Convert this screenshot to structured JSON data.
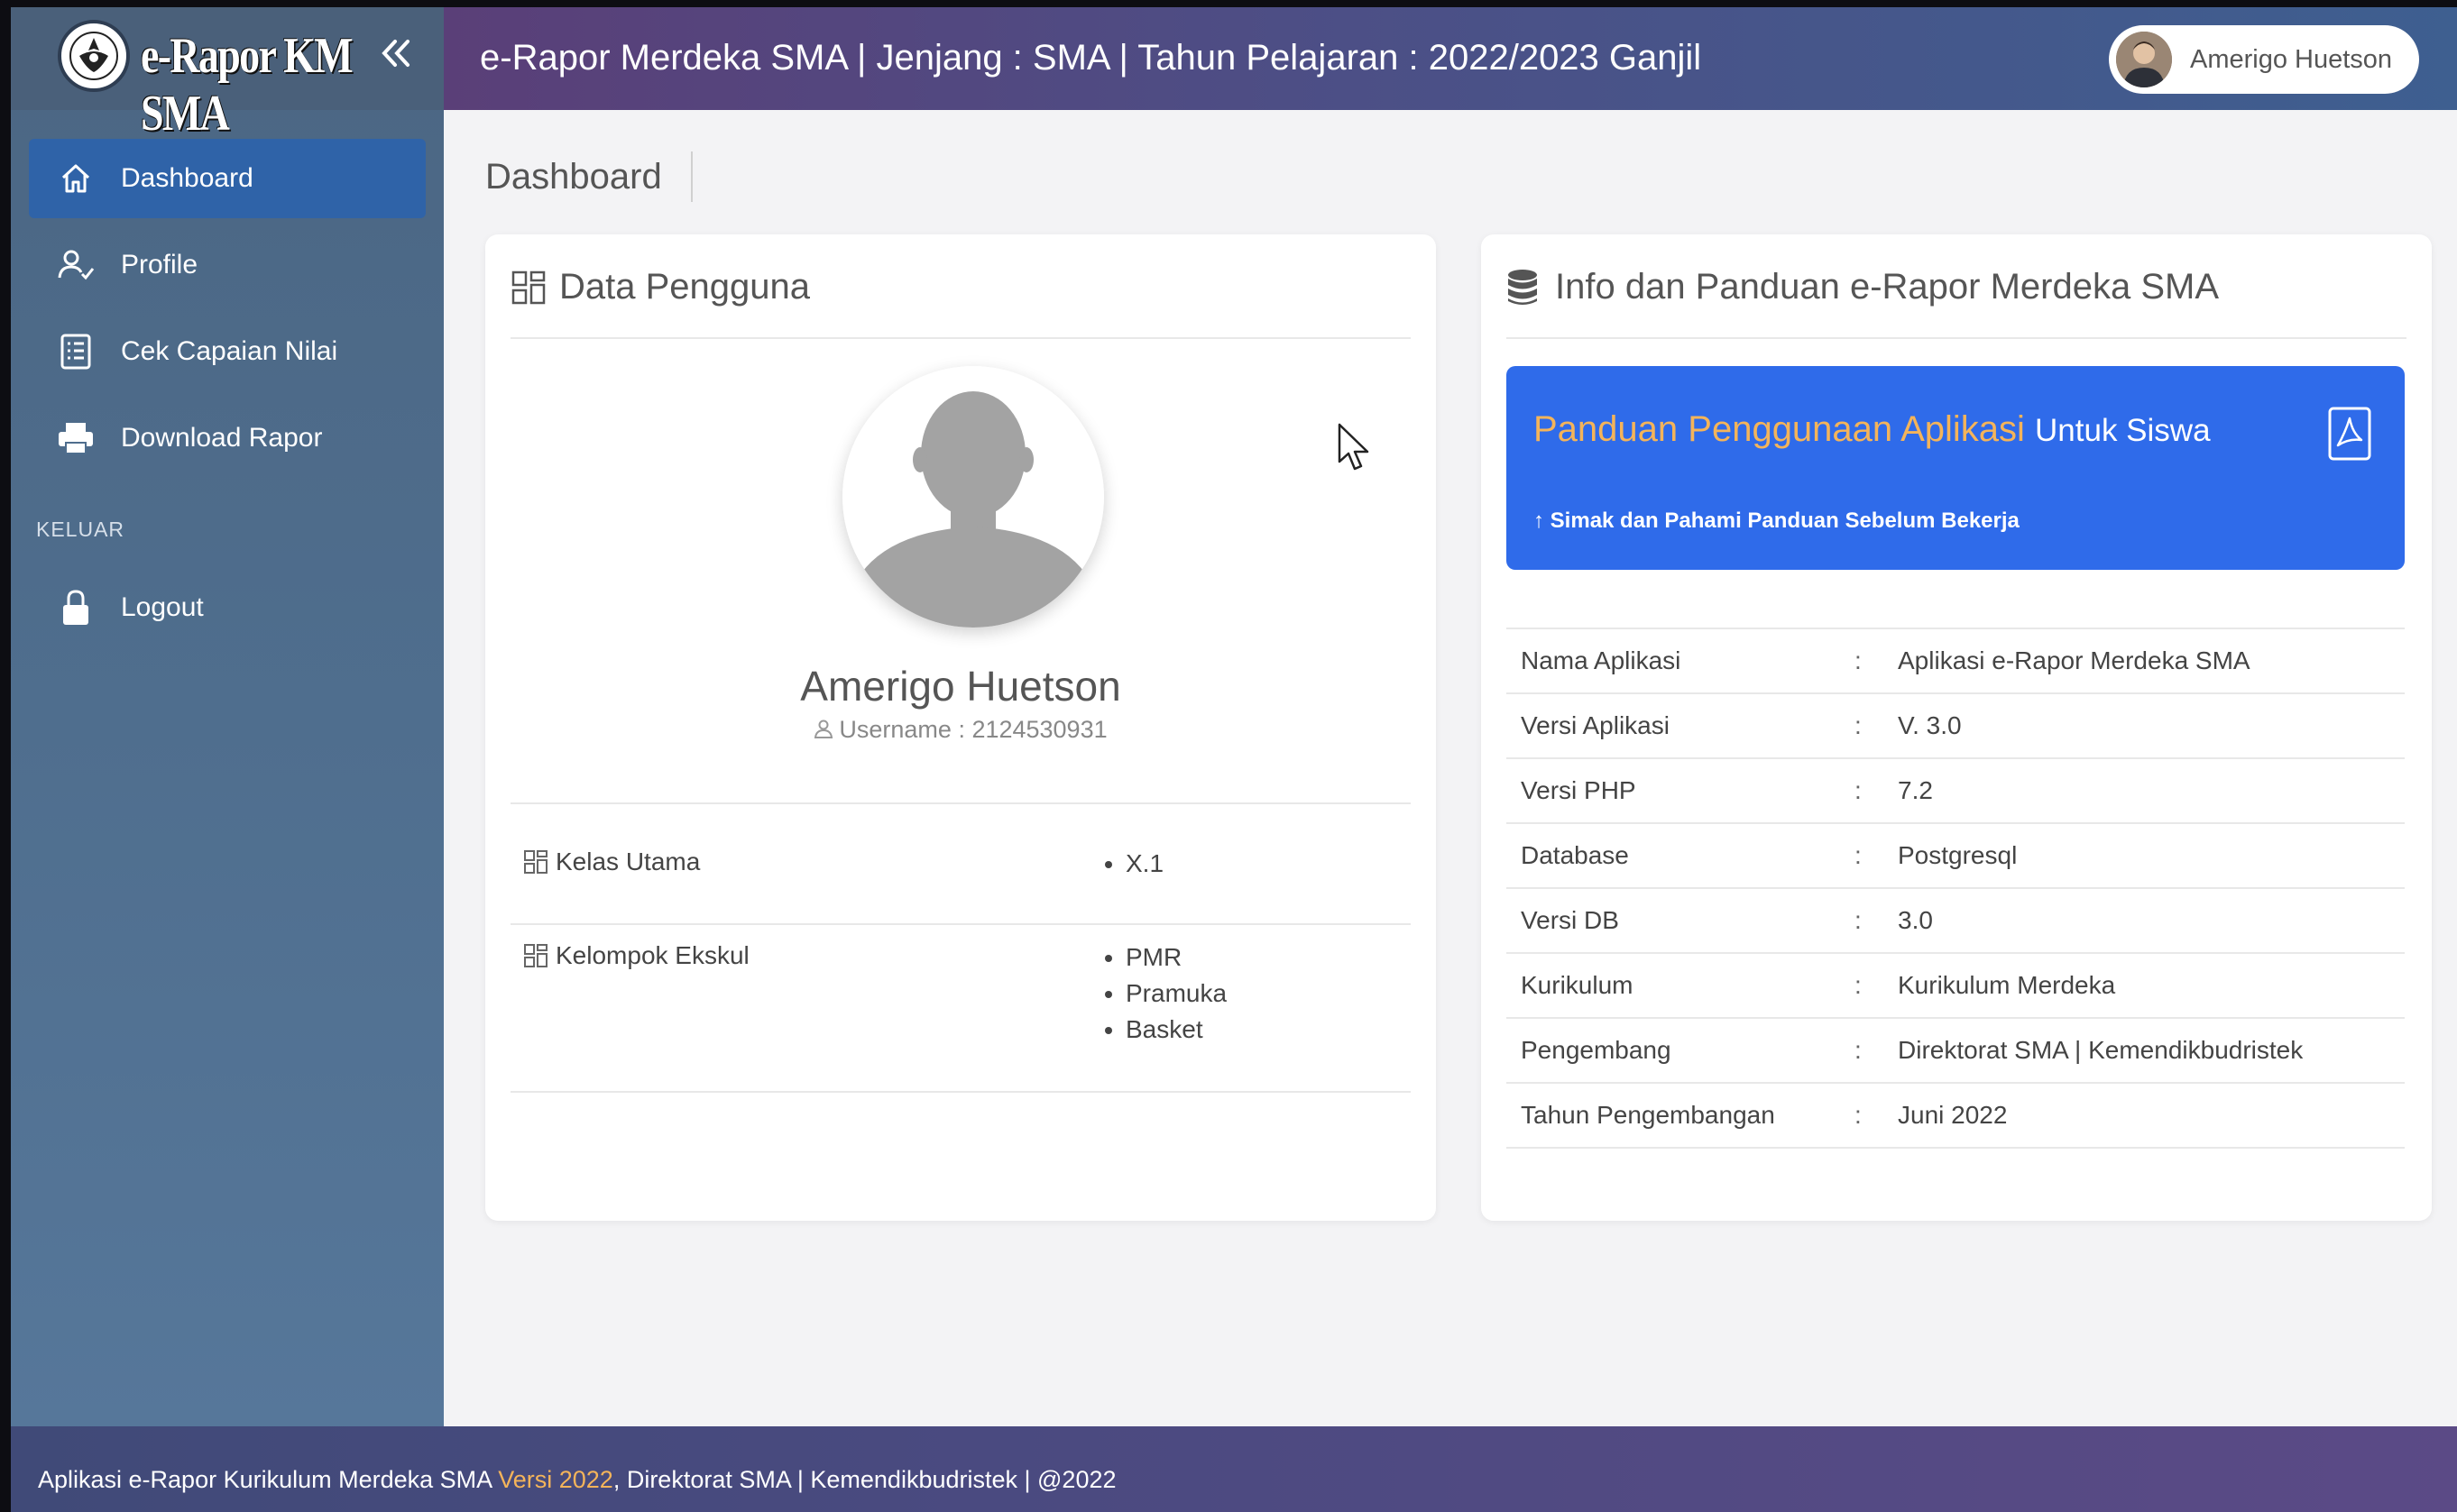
{
  "app": {
    "brand": "e-Rapor KM SMA",
    "header_title": "e-Rapor Merdeka SMA | Jenjang : SMA | Tahun Pelajaran : 2022/2023 Ganjil",
    "user_name": "Amerigo Huetson"
  },
  "sidebar": {
    "items": [
      {
        "label": "Dashboard",
        "icon": "home-icon",
        "active": true
      },
      {
        "label": "Profile",
        "icon": "user-check-icon"
      },
      {
        "label": "Cek Capaian Nilai",
        "icon": "document-list-icon"
      },
      {
        "label": "Download Rapor",
        "icon": "printer-icon"
      }
    ],
    "section_label": "KELUAR",
    "logout": {
      "label": "Logout",
      "icon": "lock-icon"
    }
  },
  "page": {
    "title": "Dashboard"
  },
  "user_card": {
    "title": "Data Pengguna",
    "name": "Amerigo Huetson",
    "username": "Username : 2124530931",
    "kelas_label": "Kelas Utama",
    "kelas_values": [
      "X.1"
    ],
    "ekskul_label": "Kelompok Ekskul",
    "ekskul_values": [
      "PMR",
      "Pramuka",
      "Basket"
    ]
  },
  "info_card": {
    "title": "Info dan Panduan e-Rapor Merdeka SMA",
    "guide": {
      "title_highlight": "Panduan Penggunaan Aplikasi",
      "title_rest": "Untuk Siswa",
      "subtitle": "Simak dan Pahami Panduan Sebelum Bekerja"
    },
    "rows": [
      {
        "key": "Nama Aplikasi",
        "value": "Aplikasi e-Rapor Merdeka SMA"
      },
      {
        "key": "Versi Aplikasi",
        "value": "V. 3.0"
      },
      {
        "key": "Versi PHP",
        "value": "7.2"
      },
      {
        "key": "Database",
        "value": "Postgresql"
      },
      {
        "key": "Versi DB",
        "value": "3.0"
      },
      {
        "key": "Kurikulum",
        "value": "Kurikulum Merdeka"
      },
      {
        "key": "Pengembang",
        "value": "Direktorat SMA | Kemendikbudristek"
      },
      {
        "key": "Tahun Pengembangan",
        "value": "Juni 2022"
      }
    ],
    "colon": ":"
  },
  "footer": {
    "prefix": "Aplikasi e-Rapor Kurikulum Merdeka SMA",
    "version": "Versi 2022",
    "suffix": ", Direktorat SMA | Kemendikbudristek | @2022"
  },
  "colors": {
    "active_nav": "#2f63a8",
    "guide_bg": "#2f6bea",
    "highlight": "#f4b45a"
  }
}
